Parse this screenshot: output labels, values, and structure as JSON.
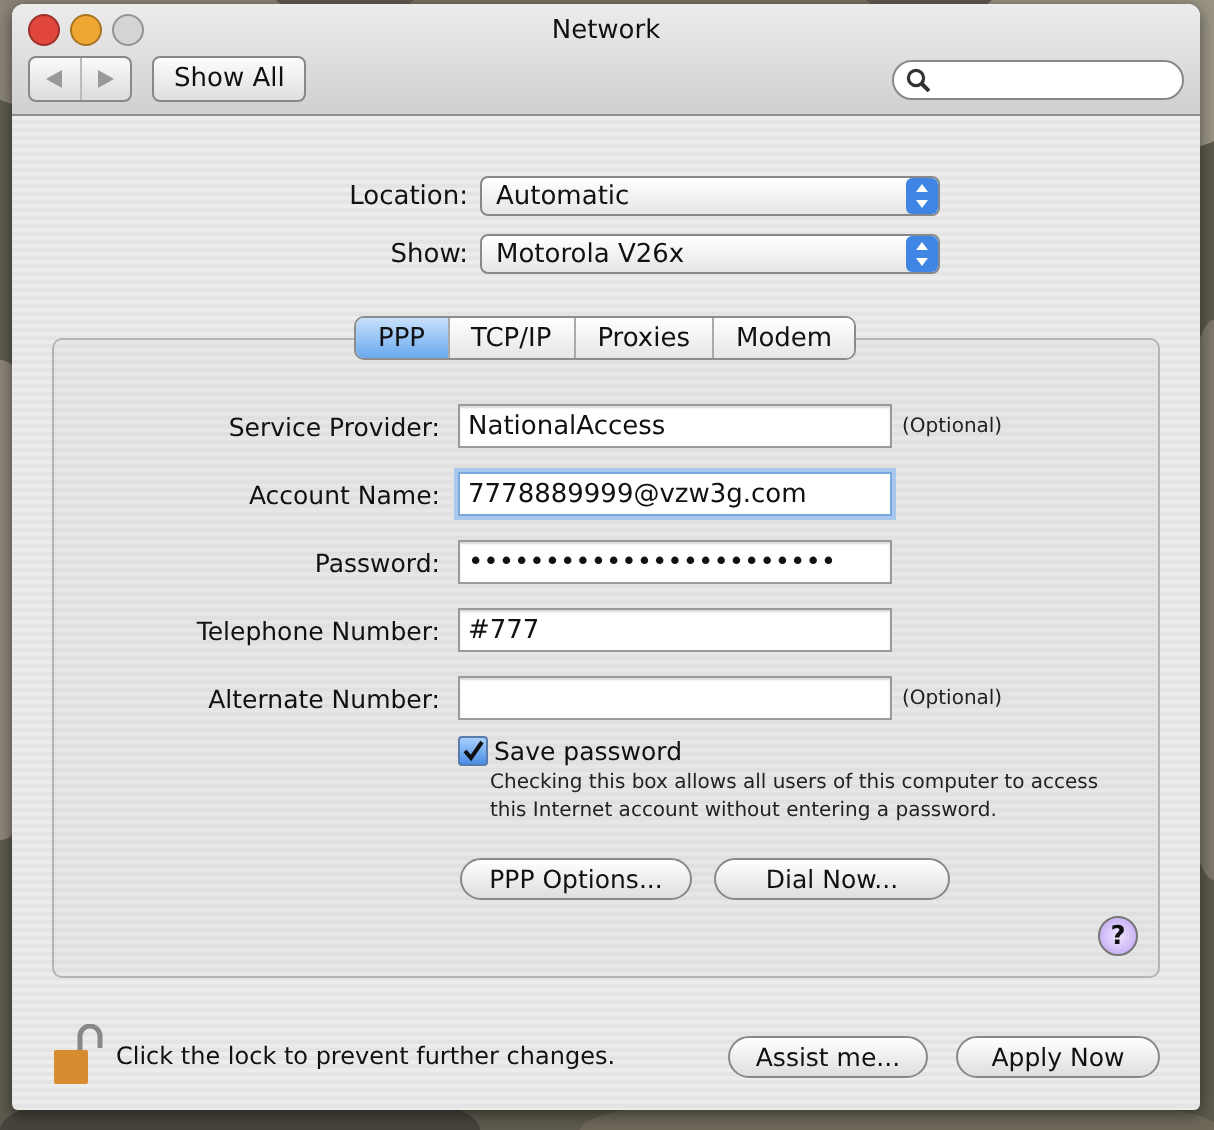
{
  "window": {
    "title": "Network"
  },
  "toolbar": {
    "show_all": "Show All"
  },
  "location": {
    "label": "Location:",
    "value": "Automatic"
  },
  "show": {
    "label": "Show:",
    "value": "Motorola V26x"
  },
  "tabs": [
    {
      "label": "PPP",
      "selected": true
    },
    {
      "label": "TCP/IP",
      "selected": false
    },
    {
      "label": "Proxies",
      "selected": false
    },
    {
      "label": "Modem",
      "selected": false
    }
  ],
  "fields": [
    {
      "label": "Service Provider:",
      "value": "NationalAccess",
      "note": "(Optional)",
      "focused": false
    },
    {
      "label": "Account Name:",
      "value": "7778889999@vzw3g.com",
      "focused": true
    },
    {
      "label": "Password:",
      "value": "••••••••••••••••••••••••",
      "focused": false
    },
    {
      "label": "Telephone Number:",
      "value": "#777",
      "focused": false
    },
    {
      "label": "Alternate Number:",
      "note": "(Optional)",
      "focused": false
    }
  ],
  "save_password": {
    "label": "Save password",
    "checked": true,
    "description": "Checking this box allows all users of this computer to access this Internet account without entering a password."
  },
  "panel_buttons": [
    "PPP Options...",
    "Dial Now..."
  ],
  "help": "?",
  "footer": {
    "lock_text": "Click the lock to prevent further changes.",
    "buttons": [
      "Assist me...",
      "Apply Now"
    ]
  }
}
